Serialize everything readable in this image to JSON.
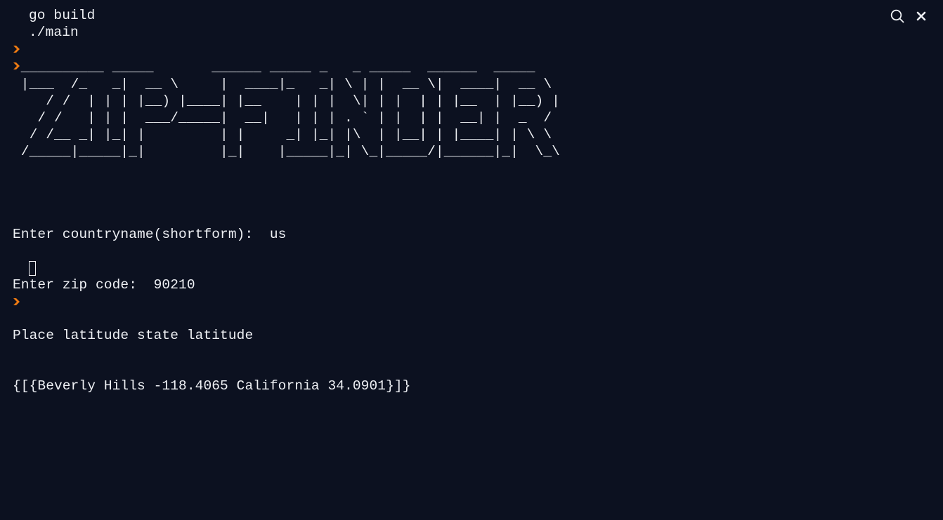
{
  "terminal": {
    "colors": {
      "background": "#0c1120",
      "text": "#eef0f4",
      "prompt": "#f07b12"
    },
    "toolbar": {
      "search_icon": "search-icon",
      "close_icon": "close-icon"
    },
    "commands": [
      {
        "text": "go build"
      },
      {
        "text": "./main"
      }
    ],
    "banner": " __________ _____       ______ _____ _   _ _____  ______  _____ \n |___  /_   _|  __ \\     |  ____|_   _| \\ | |  __ \\|  ____|  __ \\\n    / /  | | | |__) |____| |__    | | |  \\| | |  | | |__  | |__) |\n   / /   | | |  ___/_____|  __|   | | | . ` | |  | |  __| |  _  /\n  / /__ _| |_| |         | |     _| |_| |\\  | |__| | |____| | \\ \\\n /_____|_____|_|         |_|    |_____|_| \\_|_____/|______|_|  \\_\\",
    "output": [
      "Enter countryname(shortform):  us",
      "Enter zip code:  90210",
      "Place latitude state latitude",
      "{[{Beverly Hills -118.4065 California 34.0901}]}"
    ],
    "current_input": ""
  }
}
